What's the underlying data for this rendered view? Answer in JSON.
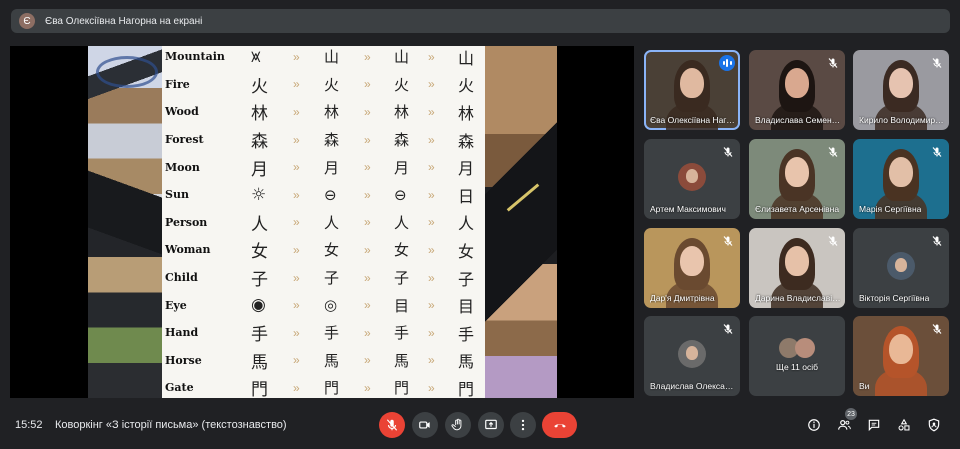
{
  "banner": {
    "avatar_letter": "Є",
    "text": "Єва Олексіївна Нагорна на екрані"
  },
  "slide": {
    "rows": [
      {
        "label": "Mountain",
        "g1": "⩙",
        "g2": "山",
        "g3": "山",
        "g4": "山"
      },
      {
        "label": "Fire",
        "g1": "火",
        "g2": "火",
        "g3": "火",
        "g4": "火"
      },
      {
        "label": "Wood",
        "g1": "林",
        "g2": "林",
        "g3": "林",
        "g4": "林"
      },
      {
        "label": "Forest",
        "g1": "森",
        "g2": "森",
        "g3": "森",
        "g4": "森"
      },
      {
        "label": "Moon",
        "g1": "月",
        "g2": "月",
        "g3": "月",
        "g4": "月"
      },
      {
        "label": "Sun",
        "g1": "☼",
        "g2": "⊖",
        "g3": "⊖",
        "g4": "日"
      },
      {
        "label": "Person",
        "g1": "人",
        "g2": "人",
        "g3": "人",
        "g4": "人"
      },
      {
        "label": "Woman",
        "g1": "女",
        "g2": "女",
        "g3": "女",
        "g4": "女"
      },
      {
        "label": "Child",
        "g1": "子",
        "g2": "子",
        "g3": "子",
        "g4": "子"
      },
      {
        "label": "Eye",
        "g1": "◉",
        "g2": "◎",
        "g3": "目",
        "g4": "目"
      },
      {
        "label": "Hand",
        "g1": "手",
        "g2": "手",
        "g3": "手",
        "g4": "手"
      },
      {
        "label": "Horse",
        "g1": "馬",
        "g2": "馬",
        "g3": "馬",
        "g4": "馬"
      },
      {
        "label": "Gate",
        "g1": "門",
        "g2": "門",
        "g3": "門",
        "g4": "門"
      }
    ],
    "arrow": "»"
  },
  "participants": [
    {
      "name": "Єва Олексіївна Нагорна",
      "bg": "#4a4036",
      "skin": "#e0b9a0",
      "hair": "#3a2a20",
      "speaking": true
    },
    {
      "name": "Владислава Семенюк",
      "bg": "#5a4a44",
      "skin": "#d9a88f",
      "hair": "#1d1512",
      "speaking": false
    },
    {
      "name": "Кирило Володимирович",
      "bg": "#9a9aa0",
      "skin": "#e6c3b0",
      "hair": "#3b2a22",
      "speaking": false
    },
    {
      "name": "Артем Максимович",
      "bg": "#3c4043",
      "avatar": "#8b4b3b",
      "speaking": false
    },
    {
      "name": "Єлизавета Арсенівна",
      "bg": "#7d8a7a",
      "skin": "#e8c4ac",
      "hair": "#4a3425",
      "speaking": false
    },
    {
      "name": "Марія Сергіївна",
      "bg": "#1d6f8f",
      "skin": "#e2bfa7",
      "hair": "#4a3322",
      "speaking": false
    },
    {
      "name": "Дар'я Дмитрівна",
      "bg": "#b9965c",
      "skin": "#e9c5ad",
      "hair": "#6a4a30",
      "speaking": false
    },
    {
      "name": "Дарина Владиславівна",
      "bg": "#c9c5c0",
      "skin": "#e6c1a8",
      "hair": "#3d2b20",
      "speaking": false
    },
    {
      "name": "Вікторія Сергіївна",
      "bg": "#3c4043",
      "avatar": "#4b5a6a",
      "speaking": false
    },
    {
      "name": "Владислав Олександрович",
      "bg": "#3c4043",
      "avatar": "#6a6a6a",
      "speaking": false
    },
    {
      "name": "Ще 11 осіб",
      "bg": "#3c4043",
      "more": true,
      "speaking": false
    },
    {
      "name": "Ви",
      "bg": "#6b4f3a",
      "skin": "#e9b896",
      "hair": "#b5542a",
      "speaking": false
    }
  ],
  "bottombar": {
    "time": "15:52",
    "title": "Коворкінг «З історії письма» (текстознавство)",
    "people_count": "23"
  },
  "colors": {
    "red": "#ea4335",
    "control_bg": "#3c4043",
    "active_outline": "#8ab4f8"
  }
}
